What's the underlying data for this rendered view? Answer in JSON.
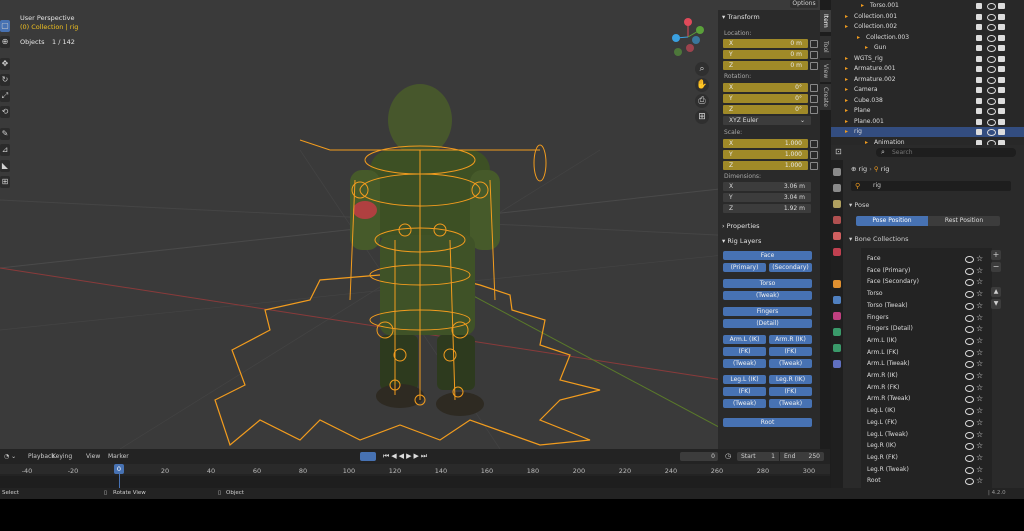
{
  "viewport": {
    "title": "User Perspective",
    "collection": "(0) Collection | rig",
    "objects_label": "Objects",
    "objects_value": "1 / 142",
    "options_label": "Options"
  },
  "side_tabs": [
    "Item",
    "Tool",
    "View",
    "Create"
  ],
  "transform": {
    "header": "Transform",
    "location_label": "Location:",
    "location": [
      {
        "k": "X",
        "v": "0 m"
      },
      {
        "k": "Y",
        "v": "0 m"
      },
      {
        "k": "Z",
        "v": "0 m"
      }
    ],
    "rotation_label": "Rotation:",
    "rotation": [
      {
        "k": "X",
        "v": "0°"
      },
      {
        "k": "Y",
        "v": "0°"
      },
      {
        "k": "Z",
        "v": "0°"
      }
    ],
    "rotation_mode": "XYZ Euler",
    "scale_label": "Scale:",
    "scale": [
      {
        "k": "X",
        "v": "1.000"
      },
      {
        "k": "Y",
        "v": "1.000"
      },
      {
        "k": "Z",
        "v": "1.000"
      }
    ],
    "dimensions_label": "Dimensions:",
    "dimensions": [
      {
        "k": "X",
        "v": "3.06 m"
      },
      {
        "k": "Y",
        "v": "3.04 m"
      },
      {
        "k": "Z",
        "v": "1.92 m"
      }
    ]
  },
  "properties_header": "Properties",
  "rig_layers": {
    "header": "Rig Layers",
    "face": "Face",
    "face_primary": "(Primary)",
    "face_secondary": "(Secondary)",
    "torso": "Torso",
    "torso_tweak": "(Tweak)",
    "fingers": "Fingers",
    "fingers_detail": "(Detail)",
    "arm_l_ik": "Arm.L (IK)",
    "arm_r_ik": "Arm.R (IK)",
    "arm_l_fk": "(FK)",
    "arm_r_fk": "(FK)",
    "arm_l_tweak": "(Tweak)",
    "arm_r_tweak": "(Tweak)",
    "leg_l_ik": "Leg.L (IK)",
    "leg_r_ik": "Leg.R (IK)",
    "leg_l_fk": "(FK)",
    "leg_r_fk": "(FK)",
    "leg_l_tweak": "(Tweak)",
    "leg_r_tweak": "(Tweak)",
    "root": "Root"
  },
  "outliner": {
    "rows": [
      {
        "name": "Torso.001",
        "indent": 30,
        "sel": false
      },
      {
        "name": "Collection.001",
        "indent": 14,
        "sel": false
      },
      {
        "name": "Collection.002",
        "indent": 14,
        "sel": false
      },
      {
        "name": "Collection.003",
        "indent": 26,
        "sel": false
      },
      {
        "name": "Gun",
        "indent": 34,
        "sel": false
      },
      {
        "name": "WGTS_rig",
        "indent": 14,
        "sel": false
      },
      {
        "name": "Armature.001",
        "indent": 14,
        "sel": false
      },
      {
        "name": "Armature.002",
        "indent": 14,
        "sel": false
      },
      {
        "name": "Camera",
        "indent": 14,
        "sel": false
      },
      {
        "name": "Cube.038",
        "indent": 14,
        "sel": false
      },
      {
        "name": "Plane",
        "indent": 14,
        "sel": false
      },
      {
        "name": "Plane.001",
        "indent": 14,
        "sel": false
      },
      {
        "name": "rig",
        "indent": 14,
        "sel": true
      },
      {
        "name": "Animation",
        "indent": 34,
        "sel": false
      }
    ]
  },
  "properties": {
    "search_placeholder": "Search",
    "breadcrumb_1": "rig",
    "breadcrumb_2": "rig",
    "object_name": "rig",
    "pose_header": "Pose",
    "pose_position": "Pose Position",
    "rest_position": "Rest Position",
    "bone_collections_header": "Bone Collections",
    "bone_collections": [
      "Face",
      "Face (Primary)",
      "Face (Secondary)",
      "Torso",
      "Torso (Tweak)",
      "Fingers",
      "Fingers (Detail)",
      "Arm.L (IK)",
      "Arm.L (FK)",
      "Arm.L (Tweak)",
      "Arm.R (IK)",
      "Arm.R (FK)",
      "Arm.R (Tweak)",
      "Leg.L (IK)",
      "Leg.L (FK)",
      "Leg.L (Tweak)",
      "Leg.R (IK)",
      "Leg.R (FK)",
      "Leg.R (Tweak)",
      "Root"
    ]
  },
  "timeline": {
    "playback": "Playback",
    "keying": "Keying",
    "view": "View",
    "marker": "Marker",
    "current_frame": "0",
    "start_label": "Start",
    "start": "1",
    "end_label": "End",
    "end": "250",
    "current_marker": "0",
    "ticks": [
      "-40",
      "-20",
      "20",
      "40",
      "60",
      "80",
      "100",
      "120",
      "140",
      "160",
      "180",
      "200",
      "220",
      "240",
      "260",
      "280",
      "300"
    ]
  },
  "status": {
    "select": "Select",
    "rotate_view": "Rotate View",
    "object": "Object",
    "version": "4.2.0"
  },
  "colors": {
    "accent": "#4772b3",
    "bone": "#f29c1e",
    "field_keyed": "#a08a28",
    "selected_row": "#334d80"
  }
}
